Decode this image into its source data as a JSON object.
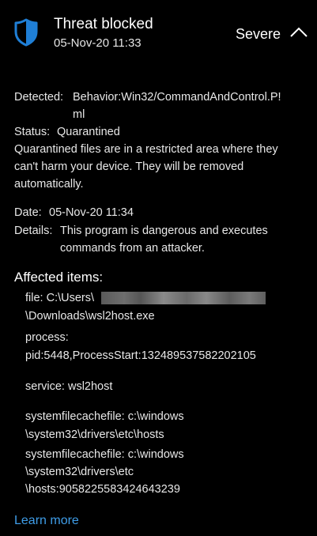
{
  "header": {
    "title": "Threat blocked",
    "timestamp": "05-Nov-20 11:33",
    "severity": "Severe",
    "shield_icon_color": "#1f7fd6"
  },
  "details": {
    "detected_label": "Detected:",
    "detected_value_line1": "Behavior:Win32/CommandAndControl.P!",
    "detected_value_line2": "ml",
    "status_label": "Status:",
    "status_value": "Quarantined",
    "status_note_line1": "Quarantined files are in a restricted area where they",
    "status_note_line2": "can't harm your device. They will be removed",
    "status_note_line3": "automatically.",
    "date_label": "Date:",
    "date_value": "05-Nov-20 11:34",
    "details_label": "Details:",
    "details_value_line1": "This program is dangerous and executes",
    "details_value_line2": "commands from an attacker."
  },
  "affected": {
    "heading": "Affected items:",
    "items": [
      {
        "line1": "file: C:\\Users\\",
        "line2": "\\Downloads\\wsl2host.exe"
      },
      {
        "line1": "process:",
        "line2": "pid:5448,ProcessStart:132489537582202105"
      },
      {
        "line1": "service: wsl2host"
      },
      {
        "line1": "systemfilecachefile: c:\\windows",
        "line2": "\\system32\\drivers\\etc\\hosts"
      },
      {
        "line1": "systemfilecachefile: c:\\windows",
        "line2": "\\system32\\drivers\\etc",
        "line3": "\\hosts:9058225583424643239"
      }
    ]
  },
  "footer": {
    "learn_more": "Learn more",
    "link_color": "#3f9de8"
  }
}
